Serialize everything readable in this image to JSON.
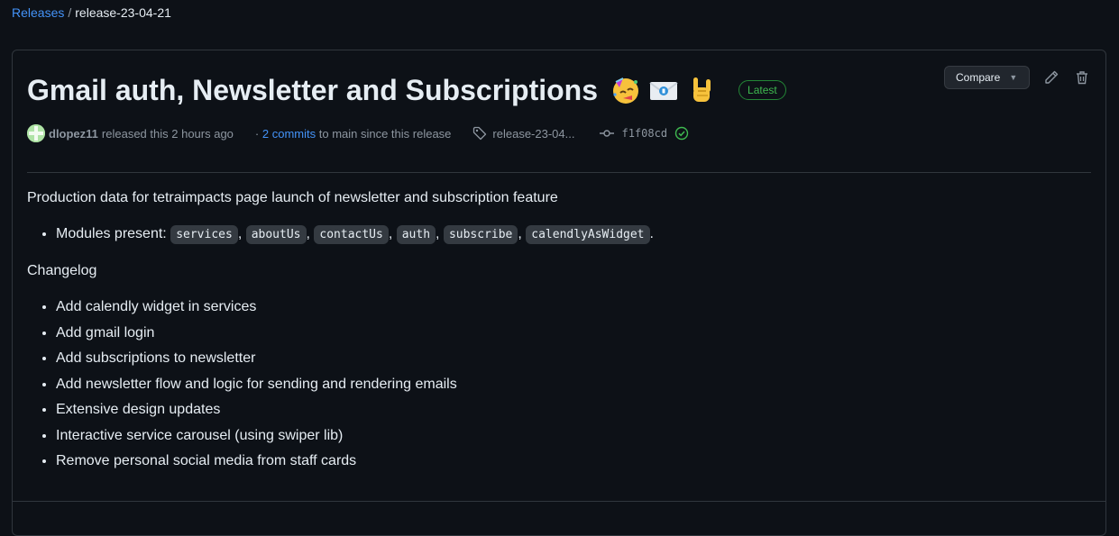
{
  "breadcrumb": {
    "root": "Releases",
    "separator": "/",
    "current": "release-23-04-21"
  },
  "release": {
    "title": "Gmail auth, Newsletter and Subscriptions",
    "emojis": [
      "partying-face",
      "envelope",
      "sign-of-the-horns"
    ],
    "badge": "Latest",
    "compare_label": "Compare",
    "author": "dlopez11",
    "released_text": "released this 2 hours ago",
    "commits_prefix": "·",
    "commits_link": "2 commits",
    "commits_suffix": "to main since this release",
    "tag": "release-23-04...",
    "commit_sha": "f1f08cd"
  },
  "body": {
    "intro": "Production data for tetraimpacts page launch of newsletter and subscription feature",
    "modules_label": "Modules present:",
    "modules": [
      "services",
      "aboutUs",
      "contactUs",
      "auth",
      "subscribe",
      "calendlyAsWidget"
    ],
    "modules_end": ".",
    "changelog_title": "Changelog",
    "changelog": [
      "Add calendly widget in services",
      "Add gmail login",
      "Add subscriptions to newsletter",
      "Add newsletter flow and logic for sending and rendering emails",
      "Extensive design updates",
      "Interactive service carousel (using swiper lib)",
      "Remove personal social media from staff cards"
    ]
  },
  "colors": {
    "background": "#0d1117",
    "link": "#4493f8",
    "badge_green": "#3fb950",
    "muted": "#8d96a0"
  }
}
